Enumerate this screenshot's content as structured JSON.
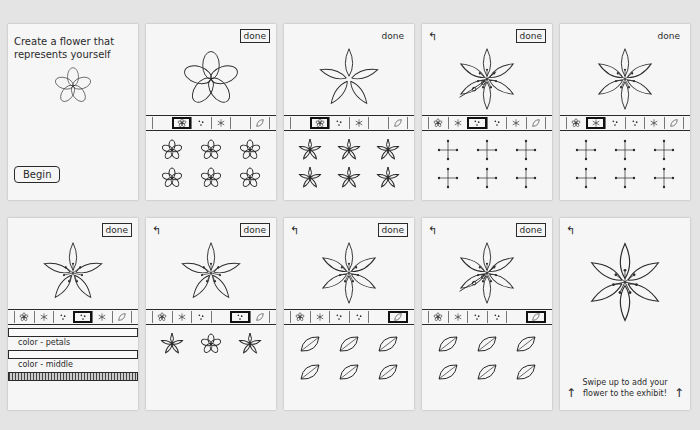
{
  "board": {
    "cards": [
      {
        "kind": "intro",
        "title": "Create a flower that represents yourself",
        "button": "Begin",
        "flower": {
          "petals": 5,
          "kind": "round",
          "center": false,
          "stem": false
        }
      },
      {
        "kind": "editor",
        "done": "done",
        "done_boxed": true,
        "flower": {
          "petals": 5,
          "kind": "round",
          "center": false,
          "stem": false
        },
        "tools": [
          {
            "kind": "blank",
            "selected": false
          },
          {
            "kind": "flower",
            "selected": true
          },
          {
            "kind": "dots",
            "selected": false
          },
          {
            "kind": "burst",
            "selected": false
          },
          {
            "kind": "blank",
            "selected": false
          },
          {
            "kind": "leaf",
            "selected": false
          }
        ],
        "options": [
          {
            "kind": "flower"
          },
          {
            "kind": "flower"
          },
          {
            "kind": "flower"
          },
          {
            "kind": "flower"
          },
          {
            "kind": "flower"
          },
          {
            "kind": "flower"
          }
        ]
      },
      {
        "kind": "editor",
        "done": "done",
        "done_boxed": false,
        "flower": {
          "petals": 5,
          "kind": "pointed",
          "center": false,
          "stem": false
        },
        "tools": [
          {
            "kind": "blank",
            "selected": false
          },
          {
            "kind": "flower",
            "selected": true
          },
          {
            "kind": "dots",
            "selected": false
          },
          {
            "kind": "burst",
            "selected": false
          },
          {
            "kind": "blank",
            "selected": false
          },
          {
            "kind": "leaf",
            "selected": false
          }
        ],
        "options": [
          {
            "kind": "pointed"
          },
          {
            "kind": "pointed"
          },
          {
            "kind": "pointed"
          },
          {
            "kind": "pointed"
          },
          {
            "kind": "pointed"
          },
          {
            "kind": "pointed"
          }
        ]
      },
      {
        "kind": "editor",
        "back": "↰",
        "done": "done",
        "done_boxed": true,
        "flower": {
          "petals": 6,
          "kind": "pointed",
          "center": true,
          "stem": true
        },
        "tools": [
          {
            "kind": "flower",
            "selected": false
          },
          {
            "kind": "burst",
            "selected": false
          },
          {
            "kind": "dots",
            "selected": true
          },
          {
            "kind": "dots",
            "selected": false
          },
          {
            "kind": "burst",
            "selected": false
          },
          {
            "kind": "leaf",
            "selected": false
          }
        ],
        "options": [
          {
            "kind": "stamen"
          },
          {
            "kind": "stamen"
          },
          {
            "kind": "stamen"
          },
          {
            "kind": "stamen"
          },
          {
            "kind": "stamen"
          },
          {
            "kind": "stamen"
          }
        ]
      },
      {
        "kind": "editor",
        "done": "done",
        "done_boxed": false,
        "flower": {
          "petals": 6,
          "kind": "pointed",
          "center": true,
          "stem": false
        },
        "tools": [
          {
            "kind": "flower",
            "selected": false
          },
          {
            "kind": "burst",
            "selected": true
          },
          {
            "kind": "dots",
            "selected": false
          },
          {
            "kind": "dots",
            "selected": false
          },
          {
            "kind": "burst",
            "selected": false
          },
          {
            "kind": "leaf",
            "selected": false
          }
        ],
        "options": [
          {
            "kind": "stamen"
          },
          {
            "kind": "stamen"
          },
          {
            "kind": "stamen"
          },
          {
            "kind": "stamen"
          },
          {
            "kind": "stamen"
          },
          {
            "kind": "stamen"
          }
        ]
      },
      {
        "kind": "editor",
        "done": "done",
        "done_boxed": true,
        "flower": {
          "petals": 5,
          "kind": "pointed",
          "center": true,
          "stem": false
        },
        "tools": [
          {
            "kind": "flower",
            "selected": false
          },
          {
            "kind": "burst",
            "selected": false
          },
          {
            "kind": "dots",
            "selected": false
          },
          {
            "kind": "dots",
            "selected": true
          },
          {
            "kind": "burst",
            "selected": false
          },
          {
            "kind": "leaf",
            "selected": false
          }
        ],
        "sliders": [
          {
            "label": "color - petals",
            "level": 0
          },
          {
            "label": "color - middle",
            "level": 0
          },
          {
            "level": 1
          }
        ]
      },
      {
        "kind": "editor",
        "back": "↰",
        "done": "done",
        "done_boxed": true,
        "flower": {
          "petals": 5,
          "kind": "pointed",
          "center": true,
          "stem": false
        },
        "tools": [
          {
            "kind": "flower",
            "selected": false
          },
          {
            "kind": "burst",
            "selected": false
          },
          {
            "kind": "dots",
            "selected": false
          },
          {
            "kind": "blank",
            "selected": false
          },
          {
            "kind": "dots",
            "selected": true
          },
          {
            "kind": "leaf",
            "selected": false
          }
        ],
        "options": [
          {
            "kind": "pointed"
          },
          {
            "kind": "flower"
          },
          {
            "kind": "pointed"
          }
        ]
      },
      {
        "kind": "editor",
        "back": "↰",
        "done": "done",
        "done_boxed": true,
        "flower": {
          "petals": 6,
          "kind": "pointed",
          "center": true,
          "stem": false
        },
        "tools": [
          {
            "kind": "flower",
            "selected": false
          },
          {
            "kind": "burst",
            "selected": false
          },
          {
            "kind": "dots",
            "selected": false
          },
          {
            "kind": "dots",
            "selected": false
          },
          {
            "kind": "blank",
            "selected": false
          },
          {
            "kind": "leaf",
            "selected": true
          }
        ],
        "options": [
          {
            "kind": "leaf"
          },
          {
            "kind": "leaf"
          },
          {
            "kind": "leaf"
          },
          {
            "kind": "leaf"
          },
          {
            "kind": "leaf"
          },
          {
            "kind": "leaf"
          }
        ]
      },
      {
        "kind": "editor",
        "back": "↰",
        "done": "done",
        "done_boxed": true,
        "flower": {
          "petals": 6,
          "kind": "pointed",
          "center": true,
          "stem": true
        },
        "tools": [
          {
            "kind": "flower",
            "selected": false
          },
          {
            "kind": "burst",
            "selected": false
          },
          {
            "kind": "dots",
            "selected": false
          },
          {
            "kind": "dots",
            "selected": false
          },
          {
            "kind": "blank",
            "selected": false
          },
          {
            "kind": "leaf",
            "selected": true
          }
        ],
        "options": [
          {
            "kind": "leaf"
          },
          {
            "kind": "leaf"
          },
          {
            "kind": "leaf"
          },
          {
            "kind": "leaf"
          },
          {
            "kind": "leaf"
          },
          {
            "kind": "leaf"
          }
        ]
      },
      {
        "kind": "final",
        "back": "↰",
        "flower": {
          "petals": 6,
          "kind": "pointed",
          "center": true,
          "stem": false
        },
        "text": "Swipe up to add your flower to the exhibit!",
        "arrows": [
          "↑",
          "↑"
        ]
      }
    ]
  }
}
